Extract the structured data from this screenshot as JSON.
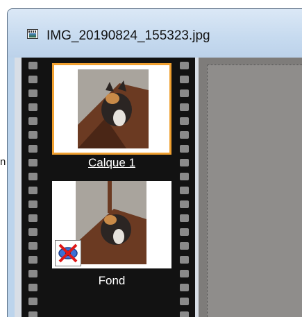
{
  "page": {
    "stray_letter": "n"
  },
  "window": {
    "title": "IMG_20190824_155323.jpg",
    "title_icon": "image-file-icon"
  },
  "layers": [
    {
      "name": "Calque 1",
      "selected": true,
      "visible": true
    },
    {
      "name": "Fond",
      "selected": false,
      "visible": false,
      "visibility_icon": "hidden-eye-icon"
    }
  ],
  "colors": {
    "selection_border": "#f0a030",
    "filmstrip": "#121212",
    "canvas": "#8f8d8b"
  }
}
